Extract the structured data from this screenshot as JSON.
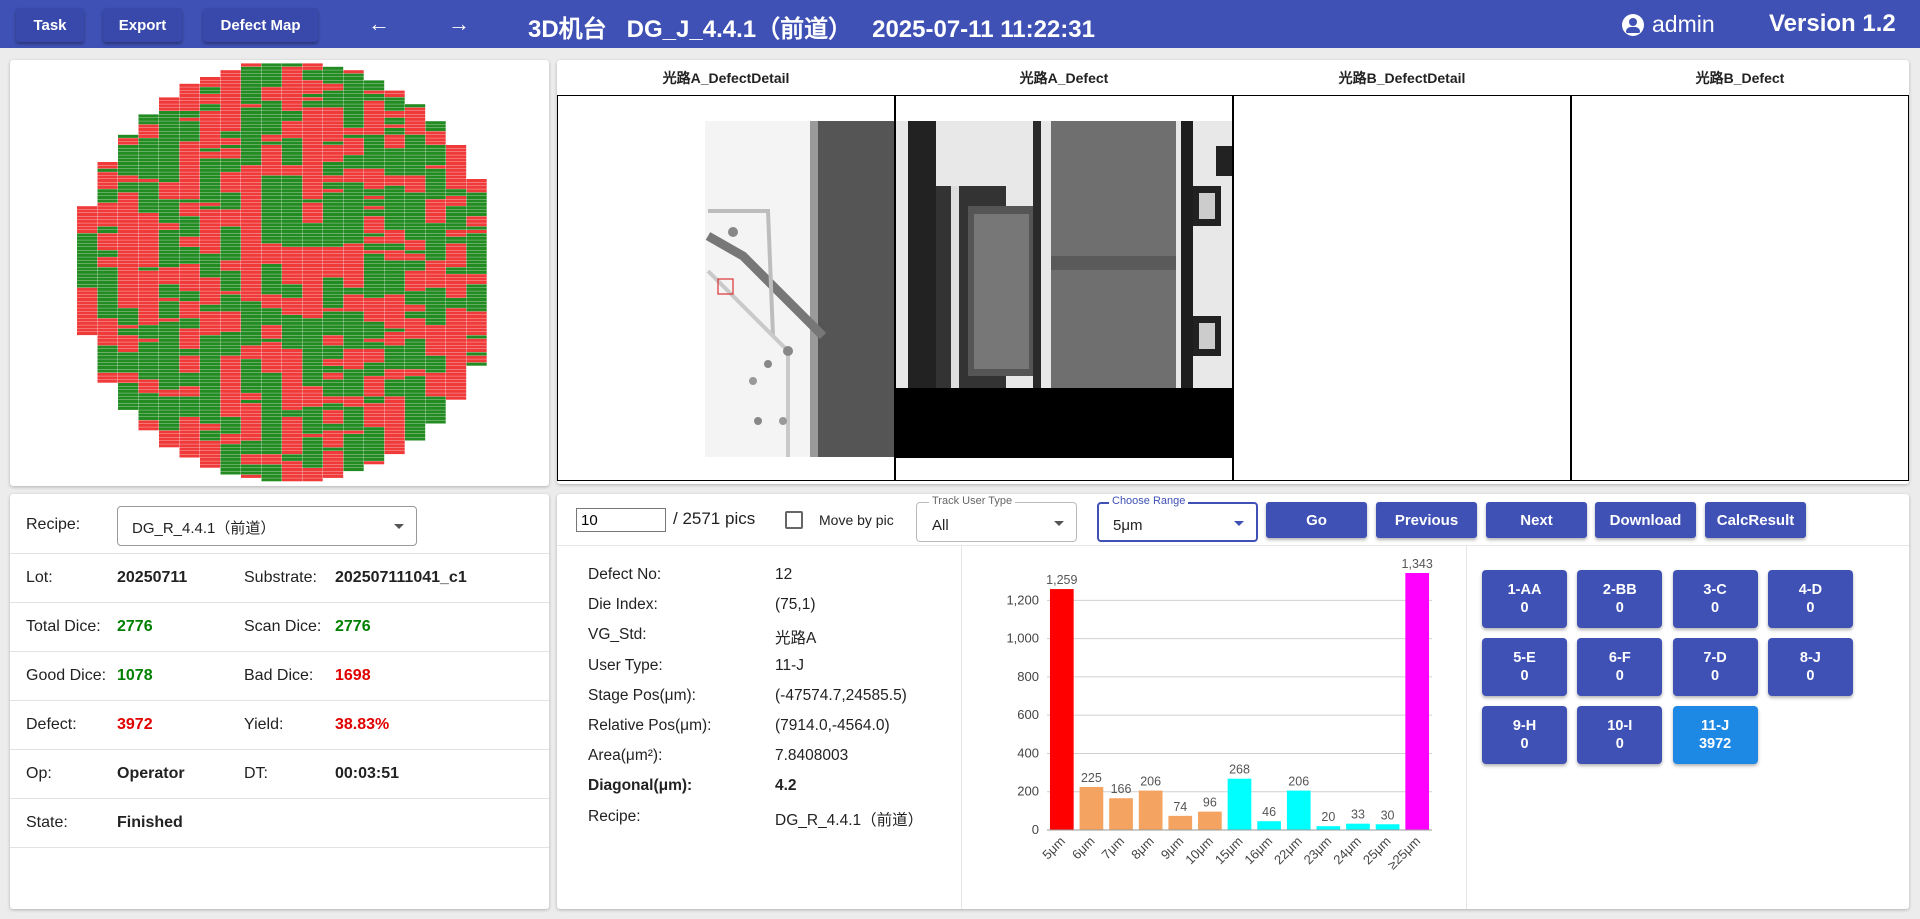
{
  "header": {
    "task_label": "Task",
    "export_label": "Export",
    "defect_map_label": "Defect Map",
    "back_icon": "arrow-left-icon",
    "forward_icon": "arrow-right-icon",
    "title": "3D机台   DG_J_4.4.1（前道）   2025-07-11 11:22:31",
    "user_icon": "account-circle-icon",
    "user": "admin",
    "version": "Version 1.2",
    "bar_color": "#3f51b5"
  },
  "wafer_map": {
    "pass_color": "#228b22",
    "fail_color": "#f03a3a"
  },
  "images": {
    "labels": [
      "光路A_DefectDetail",
      "光路A_Defect",
      "光路B_DefectDetail",
      "光路B_Defect"
    ]
  },
  "info": {
    "recipe_label": "Recipe:",
    "recipe_value": "DG_R_4.4.1（前道）",
    "lot_label": "Lot:",
    "lot_value": "20250711",
    "substrate_label": "Substrate:",
    "substrate_value": "202507111041_c1",
    "total_dice_label": "Total Dice:",
    "total_dice_value": "2776",
    "scan_dice_label": "Scan Dice:",
    "scan_dice_value": "2776",
    "good_dice_label": "Good Dice:",
    "good_dice_value": "1078",
    "bad_dice_label": "Bad Dice:",
    "bad_dice_value": "1698",
    "defect_label": "Defect:",
    "defect_value": "3972",
    "yield_label": "Yield:",
    "yield_value": "38.83%",
    "op_label": "Op:",
    "op_value": "Operator",
    "dt_label": "DT:",
    "dt_value": "00:03:51",
    "state_label": "State:",
    "state_value": "Finished"
  },
  "controls": {
    "pic_index": "10",
    "pic_total": "/ 2571 pics",
    "move_by_pic_label": "Move by pic",
    "move_by_pic_checked": false,
    "track_user_type_label": "Track User Type",
    "track_user_type_value": "All",
    "choose_range_label": "Choose Range",
    "choose_range_value": "5μm",
    "go_label": "Go",
    "previous_label": "Previous",
    "next_label": "Next",
    "download_label": "Download",
    "calc_result_label": "CalcResult"
  },
  "detail": {
    "rows": [
      {
        "label": "Defect No:",
        "value": "12"
      },
      {
        "label": "Die Index:",
        "value": "(75,1)"
      },
      {
        "label": "VG_Std:",
        "value": "光路A"
      },
      {
        "label": "User Type:",
        "value": "11-J"
      },
      {
        "label": "Stage Pos(μm):",
        "value": "(-47574.7,24585.5)"
      },
      {
        "label": "Relative Pos(μm):",
        "value": "(7914.0,-4564.0)"
      },
      {
        "label": "Area(μm²):",
        "value": "7.8408003"
      },
      {
        "label": "Diagonal(μm):",
        "value": "4.2"
      },
      {
        "label": "Recipe:",
        "value": "DG_R_4.4.1（前道）"
      }
    ]
  },
  "chart_data": {
    "type": "bar",
    "categories": [
      "5μm",
      "6μm",
      "7μm",
      "8μm",
      "9μm",
      "10μm",
      "15μm",
      "16μm",
      "22μm",
      "23μm",
      "24μm",
      "25μm",
      "≥25μm"
    ],
    "values": [
      1259,
      225,
      166,
      206,
      74,
      96,
      268,
      46,
      206,
      20,
      33,
      30,
      1343
    ],
    "data_labels": [
      "1,259",
      "225",
      "166",
      "206",
      "74",
      "96",
      "268",
      "46",
      "206",
      "20",
      "33",
      "30",
      "1,343"
    ],
    "colors": [
      "#ff0000",
      "#f4a460",
      "#f4a460",
      "#f4a460",
      "#f4a460",
      "#f4a460",
      "#00ffff",
      "#00ffff",
      "#00ffff",
      "#00ffff",
      "#00ffff",
      "#00ffff",
      "#ff00ff"
    ],
    "y_ticks": [
      0,
      200,
      400,
      600,
      800,
      1000,
      1200
    ],
    "y_tick_labels": [
      "0",
      "200",
      "400",
      "600",
      "800",
      "1,000",
      "1,200"
    ],
    "ylim": [
      0,
      1343
    ],
    "grid": true,
    "title": "",
    "xlabel": "",
    "ylabel": ""
  },
  "user_types": [
    {
      "label": "1-AA",
      "count": "0"
    },
    {
      "label": "2-BB",
      "count": "0"
    },
    {
      "label": "3-C",
      "count": "0"
    },
    {
      "label": "4-D",
      "count": "0"
    },
    {
      "label": "5-E",
      "count": "0"
    },
    {
      "label": "6-F",
      "count": "0"
    },
    {
      "label": "7-D",
      "count": "0"
    },
    {
      "label": "8-J",
      "count": "0"
    },
    {
      "label": "9-H",
      "count": "0"
    },
    {
      "label": "10-I",
      "count": "0"
    },
    {
      "label": "11-J",
      "count": "3972",
      "active": true
    }
  ]
}
